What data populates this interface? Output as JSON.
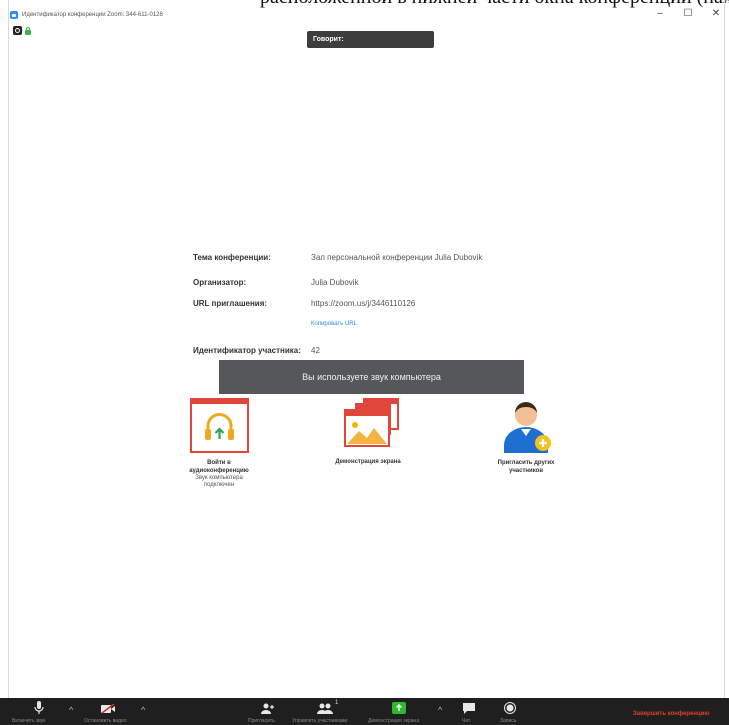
{
  "page_caption": "расположенной в нижней части окна конференции (находится",
  "window": {
    "title": "Идентификатор конференции Zoom: 344-611-0126",
    "minimize": "–",
    "maximize": "☐",
    "close": "✕"
  },
  "speaking_label": "Говорит:",
  "info": {
    "topic_label": "Тема конференции:",
    "topic_value": "Зал персональной конференции Julia Dubovik",
    "host_label": "Организатор:",
    "host_value": "Julia Dubovik",
    "url_label": "URL приглашения:",
    "url_value": "https://zoom.us/j/3446110126",
    "copy_url": "Копировать URL",
    "participant_id_label": "Идентификатор участника:",
    "participant_id_value": "42"
  },
  "toast": "Вы используете звук компьютера",
  "actions": {
    "audio": {
      "label_1": "Войти в",
      "label_2": "аудиоконференцию",
      "sub_1": "Звук компьютера",
      "sub_2": "подключен"
    },
    "share": {
      "label": "Демонстрация экрана"
    },
    "invite": {
      "label_1": "Пригласить других",
      "label_2": "участников"
    }
  },
  "toolbar": {
    "participants_count": "1",
    "end_meeting": "Завершить конференцию",
    "caption_fragments": [
      "Включить звук",
      "Остановить видео",
      "Пригласить",
      "Управлять участниками",
      "Демонстрация экрана",
      "Чат",
      "Запись"
    ]
  },
  "colors": {
    "toolbar_bg": "#1f1f1f",
    "toast_bg": "#555759",
    "accent_red": "#e0463a",
    "accent_blue": "#2d8cff",
    "end_red": "#e03e2d"
  }
}
